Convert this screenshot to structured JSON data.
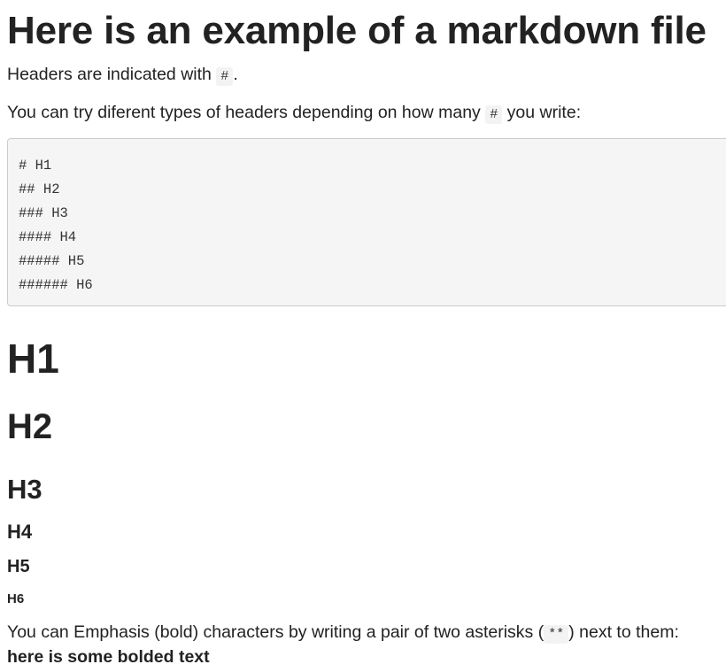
{
  "title": "Here is an example of a markdown file",
  "para1": {
    "before": "Headers are indicated with ",
    "code": "#",
    "after": "."
  },
  "para2": {
    "before": "You can try diferent types of headers depending on how many ",
    "code": "#",
    "after": " you write:"
  },
  "code_block": "# H1\n## H2\n### H3\n#### H4\n##### H5\n###### H6",
  "headers": {
    "h1": "H1",
    "h2": "H2",
    "h3": "H3",
    "h4": "H4",
    "h5": "H5",
    "h6": "H6"
  },
  "para3": {
    "before": "You can Emphasis (bold) characters by writing a pair of two asterisks (",
    "code": "**",
    "after": ") next to them:"
  },
  "bold_text": "here is some bolded text"
}
